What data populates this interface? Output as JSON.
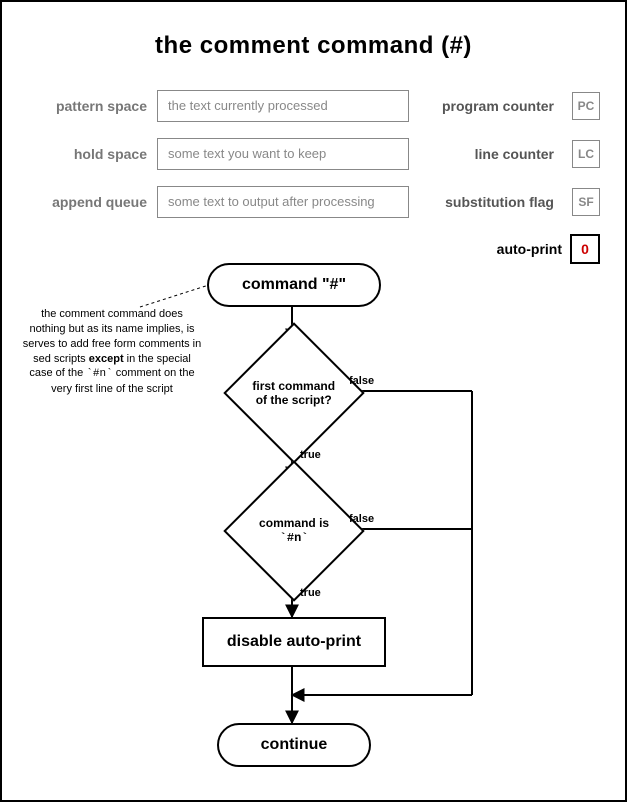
{
  "title": "the comment command (#)",
  "state": {
    "rows": [
      {
        "left": "pattern space",
        "field": "the text currently processed",
        "right": "program counter",
        "box": "PC"
      },
      {
        "left": "hold space",
        "field": "some text you want to keep",
        "right": "line counter",
        "box": "LC"
      },
      {
        "left": "append queue",
        "field": "some text to output after processing",
        "right": "substitution flag",
        "box": "SF"
      }
    ],
    "auto_print_label": "auto-print",
    "auto_print_value": "0"
  },
  "flow": {
    "start": "command \"#\"",
    "decision1": "first command of the script?",
    "decision2_prefix": "command is",
    "decision2_code": "`#n`",
    "action": "disable auto-print",
    "end": "continue",
    "true_label": "true",
    "false_label": "false"
  },
  "annotation": {
    "l1": "the comment command does nothing but as its name implies, is serves to add free form comments in sed scripts ",
    "bold": "except",
    "l2": " in the special case of the ",
    "code": "`#n`",
    "l3": " comment on the very first line of the script"
  }
}
